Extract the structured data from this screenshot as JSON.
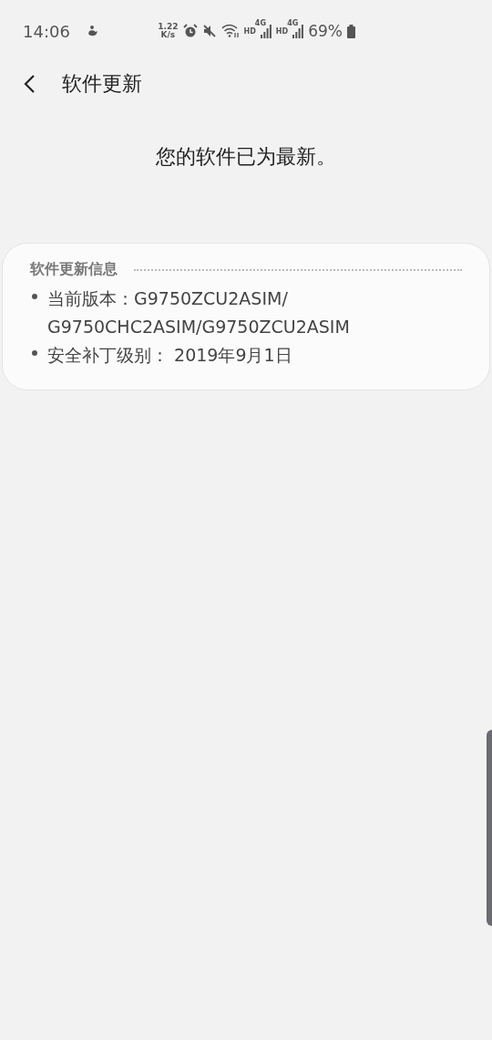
{
  "status_bar": {
    "time": "14:06",
    "net_speed_value": "1.22",
    "net_speed_unit": "K/s",
    "sim_labels": [
      {
        "hd": "HD",
        "network": "4G"
      },
      {
        "hd": "HD",
        "network": "4G"
      }
    ],
    "battery": "69%"
  },
  "header": {
    "title": "软件更新"
  },
  "message": "您的软件已为最新。",
  "info_card": {
    "title": "软件更新信息",
    "items": [
      "当前版本：G9750ZCU2ASIM/ G9750CHC2ASIM/G9750ZCU2ASIM",
      "安全补丁级别： 2019年9月1日"
    ]
  }
}
